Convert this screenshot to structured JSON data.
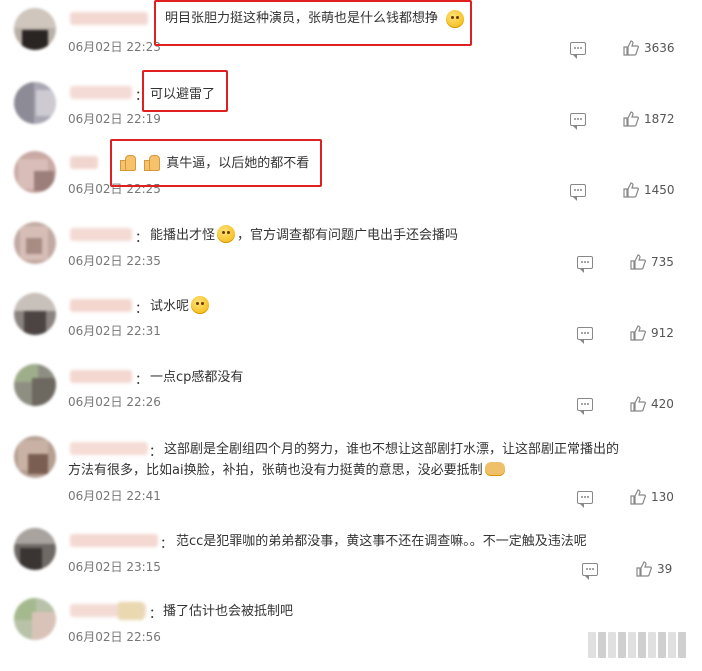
{
  "comments": [
    {
      "text": "明目张胆力挺这种演员，张萌也是什么钱都想挣",
      "time": "06月02日 22:23",
      "likes": "3636",
      "highlighted": true
    },
    {
      "text": "可以避雷了",
      "time": "06月02日 22:19",
      "likes": "1872",
      "highlighted": true
    },
    {
      "text": "真牛逼，以后她的都不看",
      "time": "06月02日 22:25",
      "likes": "1450",
      "highlighted": true
    },
    {
      "text": "能播出才怪",
      "text2": "，官方调查都有问题广电出手还会播吗",
      "time": "06月02日 22:35",
      "likes": "735"
    },
    {
      "text": "试水呢",
      "time": "06月02日 22:31",
      "likes": "912"
    },
    {
      "text": "一点cp感都没有",
      "time": "06月02日 22:26",
      "likes": "420"
    },
    {
      "text": "这部剧是全剧组四个月的努力，谁也不想让这部剧打水漂，让这部剧正常播出的方法有很多，比如ai换脸，补拍，张萌也没有力挺黄的意思，没必要抵制",
      "time": "06月02日 22:41",
      "likes": "130"
    },
    {
      "text": "范cc是犯罪咖的弟弟都没事，黄这事不还在调查嘛。。不一定触及违法呢",
      "time": "06月02日 23:15",
      "likes": "39"
    },
    {
      "text": "播了估计也会被抵制吧",
      "time": "06月02日 22:56",
      "likes": ""
    }
  ],
  "colon": "："
}
